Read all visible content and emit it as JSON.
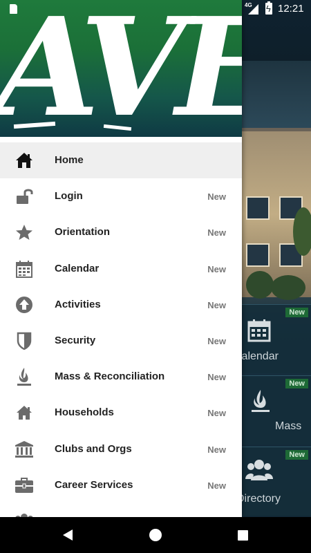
{
  "status_bar": {
    "network": "4G",
    "time": "12:21"
  },
  "header": {
    "logo_text": "AVE"
  },
  "menu": {
    "items": [
      {
        "label": "Home",
        "badge": "",
        "icon": "home-icon"
      },
      {
        "label": "Login",
        "badge": "New",
        "icon": "unlock-icon"
      },
      {
        "label": "Orientation",
        "badge": "New",
        "icon": "star-icon"
      },
      {
        "label": "Calendar",
        "badge": "New",
        "icon": "calendar-icon"
      },
      {
        "label": "Activities",
        "badge": "New",
        "icon": "arrow-up-circle-icon"
      },
      {
        "label": "Security",
        "badge": "New",
        "icon": "shield-icon"
      },
      {
        "label": "Mass & Reconciliation",
        "badge": "New",
        "icon": "flame-icon"
      },
      {
        "label": "Households",
        "badge": "New",
        "icon": "house-icon"
      },
      {
        "label": "Clubs and Orgs",
        "badge": "New",
        "icon": "bank-icon"
      },
      {
        "label": "Career Services",
        "badge": "New",
        "icon": "briefcase-icon"
      }
    ]
  },
  "background": {
    "tiles": [
      {
        "badge": "New",
        "label": "Calendar",
        "icon": "calendar-icon"
      },
      {
        "badge": "New",
        "label": "Mass",
        "icon": "flame-icon"
      },
      {
        "badge": "New",
        "label": "Directory",
        "icon": "people-icon"
      }
    ]
  },
  "colors": {
    "header_green": "#1f7a3c",
    "badge_green": "#1e6a36",
    "active_row": "#efefef",
    "icon_gray": "#6b6b6b"
  }
}
